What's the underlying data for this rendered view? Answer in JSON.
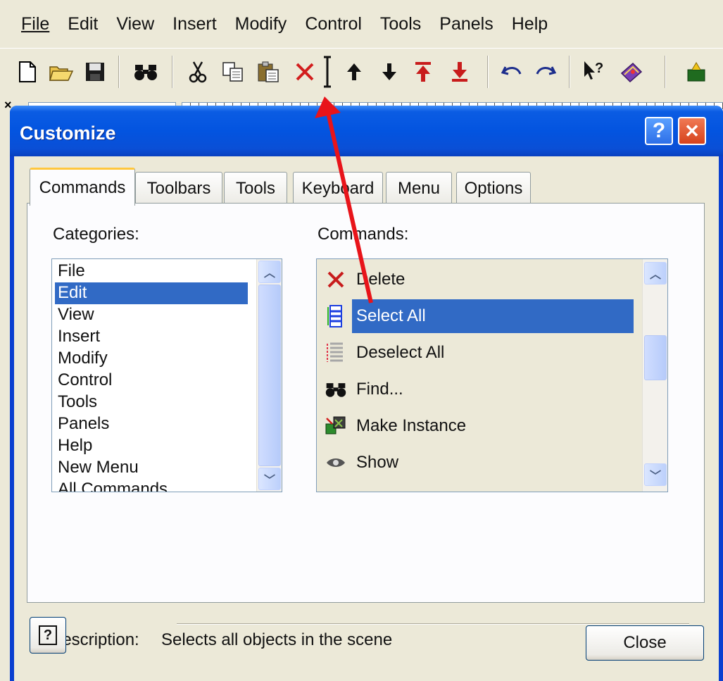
{
  "menubar": {
    "items": [
      {
        "label": "File"
      },
      {
        "label": "Edit"
      },
      {
        "label": "View"
      },
      {
        "label": "Insert"
      },
      {
        "label": "Modify"
      },
      {
        "label": "Control"
      },
      {
        "label": "Tools"
      },
      {
        "label": "Panels"
      },
      {
        "label": "Help"
      }
    ]
  },
  "toolbar": {
    "icons": [
      "new-file-icon",
      "open-folder-icon",
      "save-icon",
      "find-binoculars-icon",
      "cut-icon",
      "copy-icon",
      "paste-icon",
      "delete-icon",
      "select-all-icon",
      "move-up-icon",
      "move-down-icon",
      "move-to-top-icon",
      "move-to-bottom-icon",
      "undo-icon",
      "redo-icon",
      "context-help-icon",
      "help-book-icon",
      "instance-icon"
    ]
  },
  "dialog": {
    "title": "Customize",
    "help_glyph": "?",
    "close_glyph": "✕",
    "tabs": [
      {
        "label": "Commands",
        "active": true
      },
      {
        "label": "Toolbars"
      },
      {
        "label": "Tools"
      },
      {
        "label": "Keyboard"
      },
      {
        "label": "Menu"
      },
      {
        "label": "Options"
      }
    ],
    "categories_label": "Categories:",
    "categories": [
      "File",
      "Edit",
      "View",
      "Insert",
      "Modify",
      "Control",
      "Tools",
      "Panels",
      "Help",
      "New Menu",
      "All Commands"
    ],
    "selected_category": "Edit",
    "commands_label": "Commands:",
    "commands": [
      {
        "label": "Delete",
        "icon": "delete-icon"
      },
      {
        "label": "Select All",
        "icon": "select-all-icon"
      },
      {
        "label": "Deselect All",
        "icon": "deselect-all-icon"
      },
      {
        "label": "Find...",
        "icon": "find-binoculars-icon"
      },
      {
        "label": "Make Instance",
        "icon": "make-instance-icon"
      },
      {
        "label": "Show",
        "icon": "show-icon"
      }
    ],
    "selected_command": "Select All",
    "description_label": "Description:",
    "description_text": "Selects all objects in the scene",
    "close_button": "Close"
  },
  "colors": {
    "face": "#ece9d8",
    "title_blue": "#0354e0",
    "selection": "#316ac5",
    "annotation_arrow": "#e8141a"
  }
}
